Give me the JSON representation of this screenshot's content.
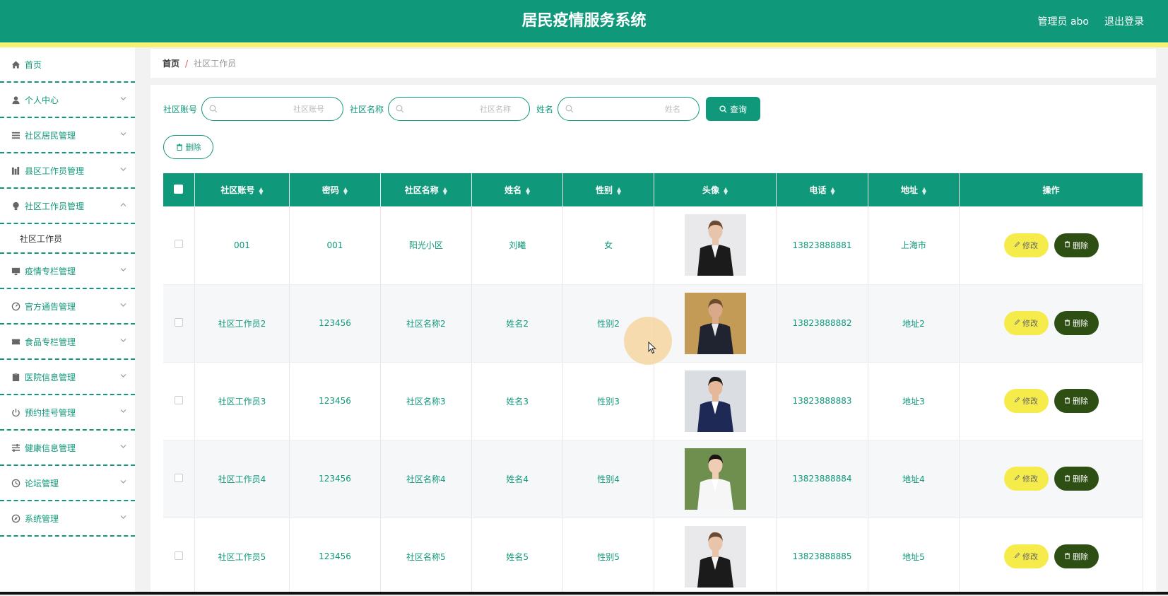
{
  "header": {
    "title": "居民疫情服务系统",
    "user": "管理员 abo",
    "logout": "退出登录"
  },
  "sidebar": {
    "items": [
      {
        "label": "首页",
        "icon": "home-icon",
        "expandable": false
      },
      {
        "label": "个人中心",
        "icon": "user-icon",
        "expandable": true
      },
      {
        "label": "社区居民管理",
        "icon": "list-icon",
        "expandable": true
      },
      {
        "label": "县区工作员管理",
        "icon": "books-icon",
        "expandable": true
      },
      {
        "label": "社区工作员管理",
        "icon": "bulb-icon",
        "expandable": true,
        "expanded": true,
        "children": [
          {
            "label": "社区工作员"
          }
        ]
      },
      {
        "label": "疫情专栏管理",
        "icon": "monitor-icon",
        "expandable": true
      },
      {
        "label": "官方通告管理",
        "icon": "gauge-icon",
        "expandable": true
      },
      {
        "label": "食品专栏管理",
        "icon": "ticket-icon",
        "expandable": true
      },
      {
        "label": "医院信息管理",
        "icon": "clipboard-icon",
        "expandable": true
      },
      {
        "label": "预约挂号管理",
        "icon": "power-icon",
        "expandable": true
      },
      {
        "label": "健康信息管理",
        "icon": "sliders-icon",
        "expandable": true
      },
      {
        "label": "论坛管理",
        "icon": "clock-icon",
        "expandable": true
      },
      {
        "label": "系统管理",
        "icon": "compass-icon",
        "expandable": true
      }
    ]
  },
  "breadcrumb": {
    "home": "首页",
    "separator": "/",
    "current": "社区工作员"
  },
  "search": {
    "fields": [
      {
        "label": "社区账号",
        "placeholder": "社区账号",
        "value": ""
      },
      {
        "label": "社区名称",
        "placeholder": "社区名称",
        "value": ""
      },
      {
        "label": "姓名",
        "placeholder": "姓名",
        "value": ""
      }
    ],
    "query_label": "查询"
  },
  "toolbar": {
    "delete_label": "删除"
  },
  "table": {
    "columns": [
      "社区账号",
      "密码",
      "社区名称",
      "姓名",
      "性别",
      "头像",
      "电话",
      "地址",
      "操作"
    ],
    "rows": [
      {
        "account": "001",
        "password": "001",
        "community": "阳光小区",
        "name": "刘曦",
        "gender": "女",
        "avatar": "woman-black-suit",
        "phone": "13823888881",
        "address": "上海市"
      },
      {
        "account": "社区工作员2",
        "password": "123456",
        "community": "社区名称2",
        "name": "姓名2",
        "gender": "性别2",
        "avatar": "man-dark-suit",
        "phone": "13823888882",
        "address": "地址2"
      },
      {
        "account": "社区工作员3",
        "password": "123456",
        "community": "社区名称3",
        "name": "姓名3",
        "gender": "性别3",
        "avatar": "man-navy-suit",
        "phone": "13823888883",
        "address": "地址3"
      },
      {
        "account": "社区工作员4",
        "password": "123456",
        "community": "社区名称4",
        "name": "姓名4",
        "gender": "性别4",
        "avatar": "woman-white-blouse",
        "phone": "13823888884",
        "address": "地址4"
      },
      {
        "account": "社区工作员5",
        "password": "123456",
        "community": "社区名称5",
        "name": "姓名5",
        "gender": "性别5",
        "avatar": "woman-black-suit",
        "phone": "13823888885",
        "address": "地址5"
      }
    ],
    "edit_label": "修改",
    "delete_label": "删除"
  },
  "colors": {
    "primary": "#10987a",
    "accent_stripe": "#f5f176",
    "edit_button": "#f5ec4b",
    "delete_button": "#2d4f13"
  }
}
